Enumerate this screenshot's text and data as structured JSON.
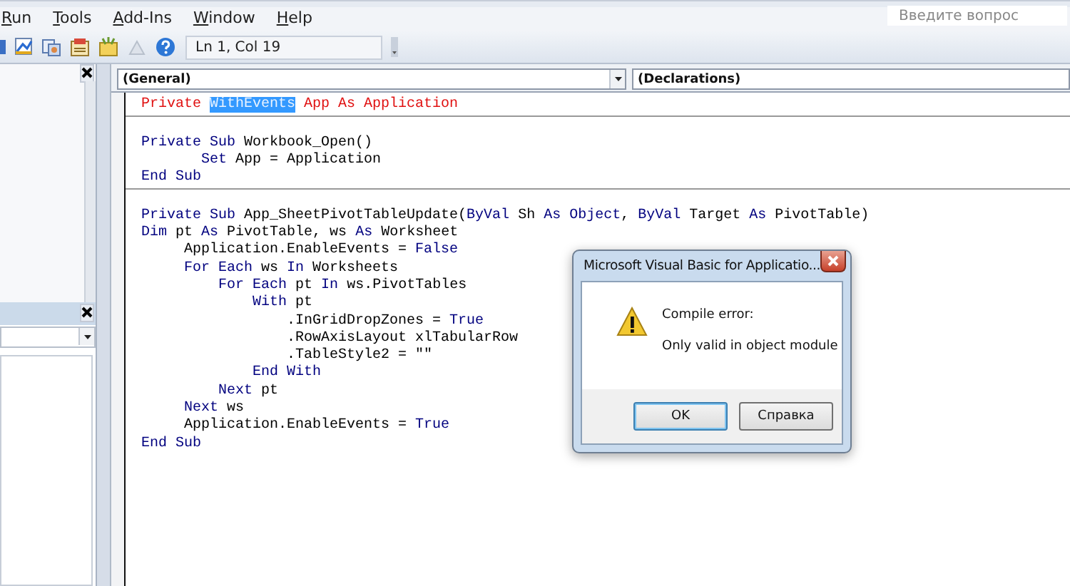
{
  "menu": [
    {
      "label": "Run"
    },
    {
      "label": "Tools"
    },
    {
      "label": "Add-Ins"
    },
    {
      "label": "Window"
    },
    {
      "label": "Help"
    }
  ],
  "help_search": {
    "placeholder": "Введите вопрос"
  },
  "toolbar": {
    "position": "Ln 1, Col 19"
  },
  "properties_panel": {
    "closable": true
  },
  "project_panel": {
    "closable": true
  },
  "code_window": {
    "object_combo": "(General)",
    "procedure_combo": "(Declarations)",
    "procedures": [
      {
        "lines": [
          {
            "error": true,
            "segments": [
              {
                "text": "Private ",
                "kind": "keyword"
              },
              {
                "text": "WithEvents",
                "kind": "selection"
              },
              {
                "text": " App As Application",
                "kind": "plain"
              }
            ]
          }
        ]
      },
      {
        "lines": [
          {
            "error": false,
            "segments": [
              {
                "text": "Private Sub ",
                "kind": "keyword"
              },
              {
                "text": "Workbook_Open()",
                "kind": "plain"
              }
            ]
          },
          {
            "error": false,
            "segments": [
              {
                "text": "       Set ",
                "kind": "keyword"
              },
              {
                "text": "App = Application",
                "kind": "plain"
              }
            ]
          },
          {
            "error": false,
            "segments": [
              {
                "text": "End Sub",
                "kind": "keyword"
              }
            ]
          }
        ]
      },
      {
        "lines": [
          {
            "error": false,
            "segments": [
              {
                "text": "Private Sub ",
                "kind": "keyword"
              },
              {
                "text": "App_SheetPivotTableUpdate(",
                "kind": "plain"
              },
              {
                "text": "ByVal ",
                "kind": "keyword"
              },
              {
                "text": "Sh ",
                "kind": "plain"
              },
              {
                "text": "As Object",
                "kind": "keyword"
              },
              {
                "text": ", ",
                "kind": "plain"
              },
              {
                "text": "ByVal ",
                "kind": "keyword"
              },
              {
                "text": "Target ",
                "kind": "plain"
              },
              {
                "text": "As ",
                "kind": "keyword"
              },
              {
                "text": "PivotTable)",
                "kind": "plain"
              }
            ]
          },
          {
            "error": false,
            "segments": [
              {
                "text": "Dim ",
                "kind": "keyword"
              },
              {
                "text": "pt ",
                "kind": "plain"
              },
              {
                "text": "As ",
                "kind": "keyword"
              },
              {
                "text": "PivotTable, ws ",
                "kind": "plain"
              },
              {
                "text": "As ",
                "kind": "keyword"
              },
              {
                "text": "Worksheet",
                "kind": "plain"
              }
            ]
          },
          {
            "error": false,
            "segments": [
              {
                "text": "     Application.EnableEvents = ",
                "kind": "plain"
              },
              {
                "text": "False",
                "kind": "keyword"
              }
            ]
          },
          {
            "error": false,
            "segments": [
              {
                "text": "     For Each ",
                "kind": "keyword"
              },
              {
                "text": "ws ",
                "kind": "plain"
              },
              {
                "text": "In ",
                "kind": "keyword"
              },
              {
                "text": "Worksheets",
                "kind": "plain"
              }
            ]
          },
          {
            "error": false,
            "segments": [
              {
                "text": "         For Each ",
                "kind": "keyword"
              },
              {
                "text": "pt ",
                "kind": "plain"
              },
              {
                "text": "In ",
                "kind": "keyword"
              },
              {
                "text": "ws.PivotTables",
                "kind": "plain"
              }
            ]
          },
          {
            "error": false,
            "segments": [
              {
                "text": "             With ",
                "kind": "keyword"
              },
              {
                "text": "pt",
                "kind": "plain"
              }
            ]
          },
          {
            "error": false,
            "segments": [
              {
                "text": "                 .InGridDropZones = ",
                "kind": "plain"
              },
              {
                "text": "True",
                "kind": "keyword"
              }
            ]
          },
          {
            "error": false,
            "segments": [
              {
                "text": "                 .RowAxisLayout xlTabularRow",
                "kind": "plain"
              }
            ]
          },
          {
            "error": false,
            "segments": [
              {
                "text": "                 .TableStyle2 = \"\"",
                "kind": "plain"
              }
            ]
          },
          {
            "error": false,
            "segments": [
              {
                "text": "             End With",
                "kind": "keyword"
              }
            ]
          },
          {
            "error": false,
            "segments": [
              {
                "text": "         Next ",
                "kind": "keyword"
              },
              {
                "text": "pt",
                "kind": "plain"
              }
            ]
          },
          {
            "error": false,
            "segments": [
              {
                "text": "     Next ",
                "kind": "keyword"
              },
              {
                "text": "ws",
                "kind": "plain"
              }
            ]
          },
          {
            "error": false,
            "segments": [
              {
                "text": "     Application.EnableEvents = ",
                "kind": "plain"
              },
              {
                "text": "True",
                "kind": "keyword"
              }
            ]
          },
          {
            "error": false,
            "segments": [
              {
                "text": "End Sub",
                "kind": "keyword"
              }
            ]
          }
        ]
      }
    ]
  },
  "dialog": {
    "title": "Microsoft Visual Basic for Applicatio...",
    "heading": "Compile error:",
    "message": "Only valid in object module",
    "buttons": [
      {
        "label": "OK",
        "default": true
      },
      {
        "label": "Справка",
        "default": false
      }
    ]
  }
}
